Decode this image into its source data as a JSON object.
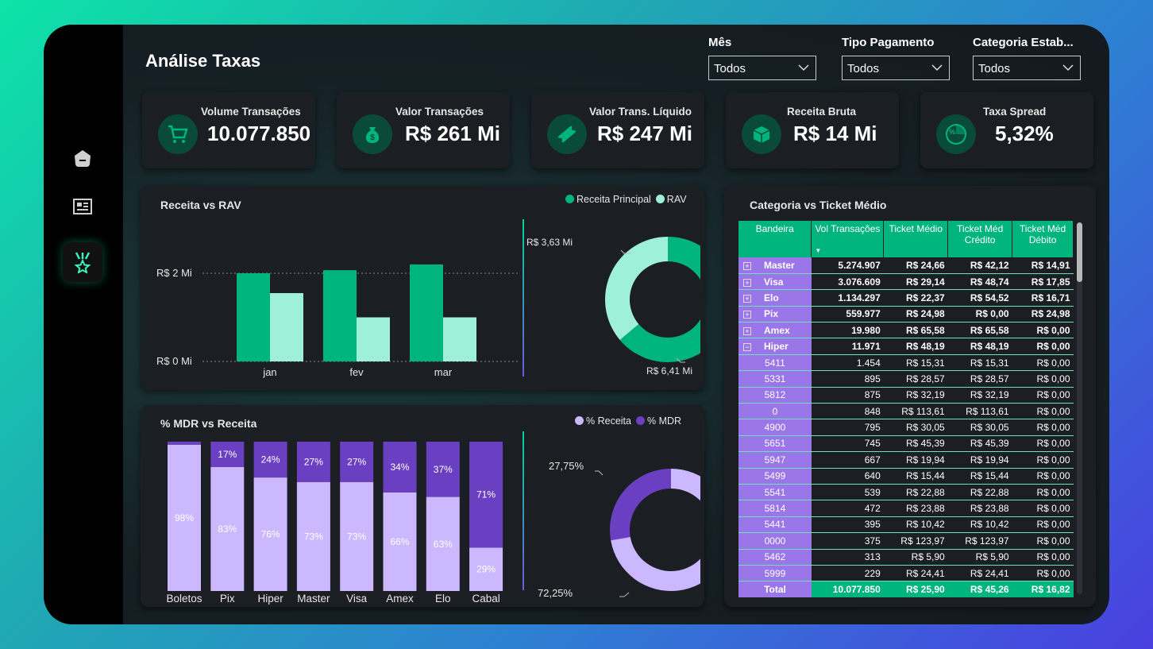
{
  "title": "Análise Taxas",
  "filters": [
    {
      "label": "Mês",
      "value": "Todos"
    },
    {
      "label": "Tipo Pagamento",
      "value": "Todos"
    },
    {
      "label": "Categoria Estab...",
      "value": "Todos"
    }
  ],
  "kpis": [
    {
      "label": "Volume Transações",
      "value": "10.077.850",
      "icon": "cart-icon"
    },
    {
      "label": "Valor Transações",
      "value": "R$ 261 Mi",
      "icon": "money-bag-icon"
    },
    {
      "label": "Valor Trans. Líquido",
      "value": "R$ 247 Mi",
      "icon": "ticket-icon"
    },
    {
      "label": "Receita Bruta",
      "value": "R$ 14 Mi",
      "icon": "box-icon"
    },
    {
      "label": "Taxa Spread",
      "value": "5,32%",
      "icon": "percent-pie-icon"
    }
  ],
  "receita_chart": {
    "title": "Receita  vs RAV",
    "legend": [
      "Receita Principal",
      "RAV"
    ],
    "colors": {
      "primary": "#00b47d",
      "secondary": "#9ff0d8"
    },
    "y_ticks": [
      "R$ 2 Mi",
      "R$ 0 Mi"
    ],
    "donut_labels": {
      "rav": "R$ 3,63 Mi",
      "principal": "R$ 6,41 Mi"
    }
  },
  "mdr_chart": {
    "title": "% MDR vs Receita",
    "legend": [
      "% Receita",
      "% MDR"
    ],
    "colors": {
      "receita": "#cbb8ff",
      "mdr": "#6a3fc1"
    },
    "donut_labels": {
      "mdr": "27,75%",
      "receita": "72,25%"
    }
  },
  "chart_data": [
    {
      "type": "bar",
      "title": "Receita  vs RAV",
      "categories": [
        "jan",
        "fev",
        "mar"
      ],
      "series": [
        {
          "name": "Receita Principal",
          "values": [
            2.0,
            2.07,
            2.2
          ]
        },
        {
          "name": "RAV",
          "values": [
            1.55,
            1.0,
            1.0
          ]
        }
      ],
      "ylabel": "",
      "ylim": [
        0,
        2.6
      ],
      "y_tick_values": [
        0,
        2
      ]
    },
    {
      "type": "pie",
      "donut": true,
      "categories": [
        "Receita Principal",
        "RAV"
      ],
      "values": [
        6.41,
        3.63
      ]
    },
    {
      "type": "bar",
      "stacked": true,
      "title": "% MDR vs Receita",
      "categories": [
        "Boletos",
        "Pix",
        "Hiper",
        "Master",
        "Visa",
        "Amex",
        "Elo",
        "Cabal"
      ],
      "series": [
        {
          "name": "% Receita",
          "values": [
            98,
            83,
            76,
            73,
            73,
            66,
            63,
            29
          ],
          "labels": [
            "98%",
            "83%",
            "76%",
            "73%",
            "73%",
            "66%",
            "63%",
            "29%"
          ]
        },
        {
          "name": "% MDR",
          "values": [
            2,
            17,
            24,
            27,
            27,
            34,
            37,
            71
          ],
          "labels": [
            "",
            "17%",
            "24%",
            "27%",
            "27%",
            "34%",
            "37%",
            "71%"
          ]
        }
      ],
      "ylim": [
        0,
        100
      ]
    },
    {
      "type": "pie",
      "donut": true,
      "categories": [
        "% Receita",
        "% MDR"
      ],
      "values": [
        72.25,
        27.75
      ]
    }
  ],
  "table": {
    "title": "Categoria vs Ticket Médio",
    "headers": [
      "Bandeira",
      "Vol Transações",
      "Ticket Médio",
      "Ticket Méd Crédito",
      "Ticket Méd Débito"
    ],
    "rows": [
      {
        "group": true,
        "expanded": false,
        "cells": [
          "Master",
          "5.274.907",
          "R$ 24,66",
          "R$ 42,12",
          "R$ 14,91"
        ]
      },
      {
        "group": true,
        "expanded": false,
        "cells": [
          "Visa",
          "3.076.609",
          "R$ 29,14",
          "R$ 48,74",
          "R$ 17,85"
        ]
      },
      {
        "group": true,
        "expanded": false,
        "cells": [
          "Elo",
          "1.134.297",
          "R$ 22,37",
          "R$ 54,52",
          "R$ 16,71"
        ]
      },
      {
        "group": true,
        "expanded": false,
        "cells": [
          "Pix",
          "559.977",
          "R$ 24,98",
          "R$ 0,00",
          "R$ 24,98"
        ]
      },
      {
        "group": true,
        "expanded": false,
        "cells": [
          "Amex",
          "19.980",
          "R$ 65,58",
          "R$ 65,58",
          "R$ 0,00"
        ]
      },
      {
        "group": true,
        "expanded": true,
        "cells": [
          "Hiper",
          "11.971",
          "R$ 48,19",
          "R$ 48,19",
          "R$ 0,00"
        ]
      },
      {
        "group": false,
        "cells": [
          "5411",
          "1.454",
          "R$ 15,31",
          "R$ 15,31",
          "R$ 0,00"
        ]
      },
      {
        "group": false,
        "cells": [
          "5331",
          "895",
          "R$ 28,57",
          "R$ 28,57",
          "R$ 0,00"
        ]
      },
      {
        "group": false,
        "cells": [
          "5812",
          "875",
          "R$ 32,19",
          "R$ 32,19",
          "R$ 0,00"
        ]
      },
      {
        "group": false,
        "cells": [
          "0",
          "848",
          "R$ 113,61",
          "R$ 113,61",
          "R$ 0,00"
        ]
      },
      {
        "group": false,
        "cells": [
          "4900",
          "795",
          "R$ 30,05",
          "R$ 30,05",
          "R$ 0,00"
        ]
      },
      {
        "group": false,
        "cells": [
          "5651",
          "745",
          "R$ 45,39",
          "R$ 45,39",
          "R$ 0,00"
        ]
      },
      {
        "group": false,
        "cells": [
          "5947",
          "667",
          "R$ 19,94",
          "R$ 19,94",
          "R$ 0,00"
        ]
      },
      {
        "group": false,
        "cells": [
          "5499",
          "640",
          "R$ 15,44",
          "R$ 15,44",
          "R$ 0,00"
        ]
      },
      {
        "group": false,
        "cells": [
          "5541",
          "539",
          "R$ 22,88",
          "R$ 22,88",
          "R$ 0,00"
        ]
      },
      {
        "group": false,
        "cells": [
          "5814",
          "472",
          "R$ 23,88",
          "R$ 23,88",
          "R$ 0,00"
        ]
      },
      {
        "group": false,
        "cells": [
          "5441",
          "395",
          "R$ 10,42",
          "R$ 10,42",
          "R$ 0,00"
        ]
      },
      {
        "group": false,
        "cells": [
          "0000",
          "375",
          "R$ 123,97",
          "R$ 123,97",
          "R$ 0,00"
        ]
      },
      {
        "group": false,
        "cells": [
          "5462",
          "313",
          "R$ 5,90",
          "R$ 5,90",
          "R$ 0,00"
        ]
      },
      {
        "group": false,
        "cells": [
          "5999",
          "229",
          "R$ 24,41",
          "R$ 24,41",
          "R$ 0,00"
        ]
      }
    ],
    "total": [
      "Total",
      "10.077.850",
      "R$ 25,90",
      "R$ 45,26",
      "R$ 16,82"
    ]
  },
  "nav": [
    {
      "icon": "home-icon",
      "active": false
    },
    {
      "icon": "report-icon",
      "active": false
    },
    {
      "icon": "medal-star-icon",
      "active": true
    }
  ]
}
